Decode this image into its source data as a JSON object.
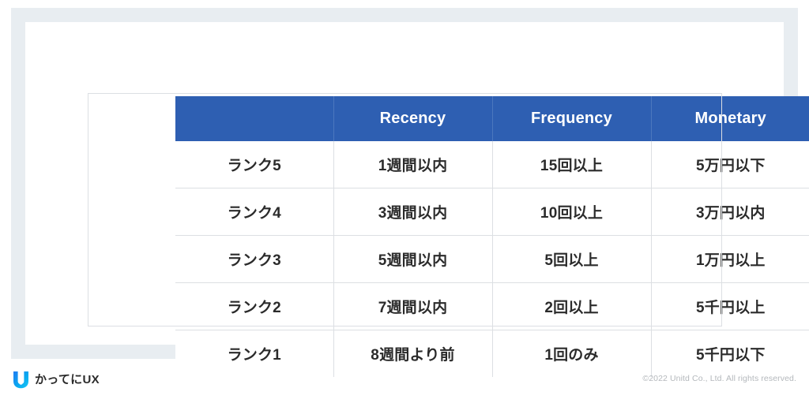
{
  "slide": {
    "frame_color": "#e8edf1",
    "card_color": "#ffffff"
  },
  "table": {
    "header_bg": "#2e5fb2",
    "header_text_color": "#ffffff",
    "border_color": "#dcdfe3",
    "corner_label": "",
    "columns": [
      "",
      "Recency",
      "Frequency",
      "Monetary"
    ],
    "rows": [
      {
        "rank": "ランク5",
        "recency": "1週間以内",
        "frequency": "15回以上",
        "monetary": "5万円以下"
      },
      {
        "rank": "ランク4",
        "recency": "3週間以内",
        "frequency": "10回以上",
        "monetary": "3万円以内"
      },
      {
        "rank": "ランク3",
        "recency": "5週間以内",
        "frequency": "5回以上",
        "monetary": "1万円以上"
      },
      {
        "rank": "ランク2",
        "recency": "7週間以内",
        "frequency": "2回以上",
        "monetary": "5千円以上"
      },
      {
        "rank": "ランク1",
        "recency": "8週間より前",
        "frequency": "1回のみ",
        "monetary": "5千円以下"
      }
    ]
  },
  "footer": {
    "brand_icon": "u-logo-icon",
    "brand_name": "かってにUX",
    "brand_color": "#0aa8f0",
    "copyright": "©2022 Unitd Co., Ltd. All rights reserved."
  }
}
